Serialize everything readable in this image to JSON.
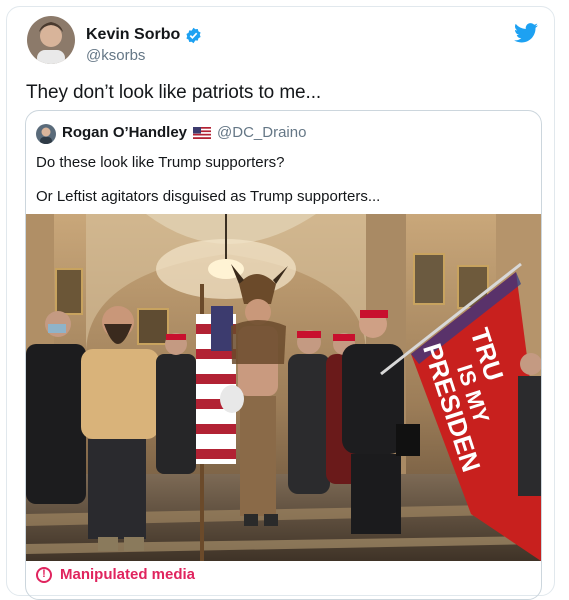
{
  "tweet": {
    "author_name": "Kevin Sorbo",
    "author_handle": "@ksorbs",
    "text": "They don’t look like patriots to me...",
    "icons": {
      "verified": "verified-badge-icon",
      "brand": "twitter-bird-icon"
    },
    "colors": {
      "verified": "#1da1f2",
      "brand": "#1da1f2"
    }
  },
  "quoted": {
    "author_name": "Rogan O’Handley",
    "author_handle": "@DC_Draino",
    "line1": "Do these look like Trump supporters?",
    "line2": "Or Leftist agitators disguised as Trump supporters...",
    "flag_icon": "us-flag-icon",
    "photo": {
      "flag_text_line1": "TRU",
      "flag_text_line2": "IS MY",
      "flag_text_line3": "PRESIDEN"
    },
    "label": {
      "text": "Manipulated media",
      "icon": "exclamation-circle-icon",
      "color": "#e0245e"
    }
  }
}
